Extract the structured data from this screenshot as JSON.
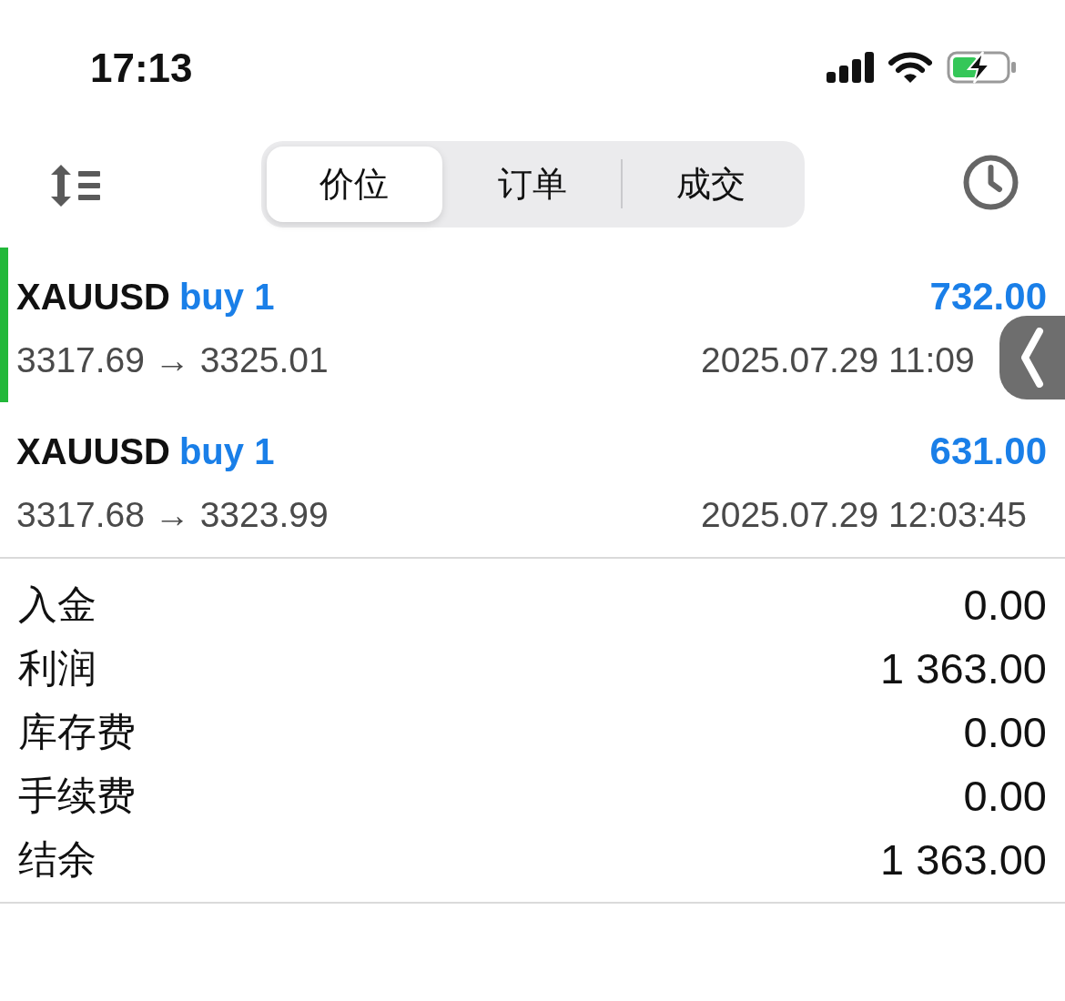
{
  "status_bar": {
    "time": "17:13"
  },
  "segments": [
    {
      "label": "价位",
      "selected": true
    },
    {
      "label": "订单",
      "selected": false
    },
    {
      "label": "成交",
      "selected": false
    }
  ],
  "trades": [
    {
      "symbol": "XAUUSD",
      "side": "buy 1",
      "profit": "732.00",
      "prices": "3317.69 → 3325.01",
      "time": "2025.07.29 11:09",
      "selected": true
    },
    {
      "symbol": "XAUUSD",
      "side": "buy 1",
      "profit": "631.00",
      "prices": "3317.68 → 3323.99",
      "time": "2025.07.29 12:03:45",
      "selected": false
    }
  ],
  "summary": [
    {
      "label": "入金",
      "value": "0.00"
    },
    {
      "label": "利润",
      "value": "1 363.00"
    },
    {
      "label": "库存费",
      "value": "0.00"
    },
    {
      "label": "手续费",
      "value": "0.00"
    },
    {
      "label": "结余",
      "value": "1 363.00"
    }
  ]
}
